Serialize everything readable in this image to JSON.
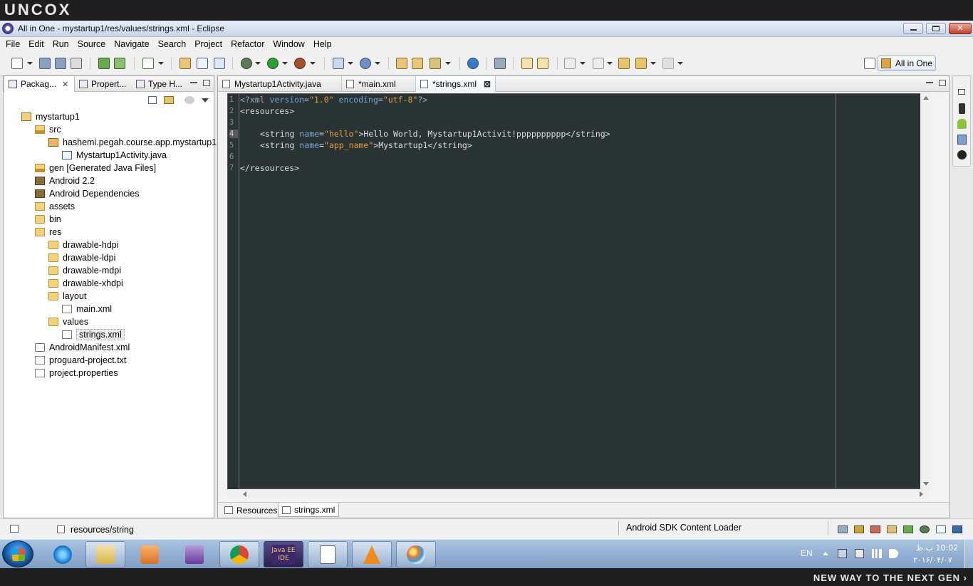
{
  "banner": {
    "logo_text": "UNCOX"
  },
  "window": {
    "title": "All in One - mystartup1/res/values/strings.xml - Eclipse"
  },
  "menu": [
    "File",
    "Edit",
    "Run",
    "Source",
    "Navigate",
    "Search",
    "Project",
    "Refactor",
    "Window",
    "Help"
  ],
  "perspective": {
    "label": "All in One"
  },
  "left_view": {
    "tabs": [
      "Packag...",
      "Propert...",
      "Type H..."
    ],
    "tree": [
      {
        "label": "mystartup1",
        "icon": "project-icon",
        "level": 0
      },
      {
        "label": "src",
        "icon": "source-folder-icon",
        "level": 1
      },
      {
        "label": "hashemi.pegah.course.app.mystartup1",
        "icon": "package-icon",
        "level": 2
      },
      {
        "label": "Mystartup1Activity.java",
        "icon": "java-file-icon",
        "level": 3
      },
      {
        "label": "gen [Generated Java Files]",
        "icon": "source-folder-icon",
        "level": 1
      },
      {
        "label": "Android 2.2",
        "icon": "library-icon",
        "level": 1
      },
      {
        "label": "Android Dependencies",
        "icon": "library-icon",
        "level": 1
      },
      {
        "label": "assets",
        "icon": "folder-icon",
        "level": 1
      },
      {
        "label": "bin",
        "icon": "folder-icon",
        "level": 1
      },
      {
        "label": "res",
        "icon": "folder-icon",
        "level": 1
      },
      {
        "label": "drawable-hdpi",
        "icon": "folder-icon",
        "level": 2
      },
      {
        "label": "drawable-ldpi",
        "icon": "folder-icon",
        "level": 2
      },
      {
        "label": "drawable-mdpi",
        "icon": "folder-icon",
        "level": 2
      },
      {
        "label": "drawable-xhdpi",
        "icon": "folder-icon",
        "level": 2
      },
      {
        "label": "layout",
        "icon": "folder-icon",
        "level": 2
      },
      {
        "label": "main.xml",
        "icon": "xml-file-icon",
        "level": 3
      },
      {
        "label": "values",
        "icon": "folder-icon",
        "level": 2
      },
      {
        "label": "strings.xml",
        "icon": "xml-file-icon",
        "level": 3,
        "selected": true
      },
      {
        "label": "AndroidManifest.xml",
        "icon": "xml-file-icon",
        "level": 1
      },
      {
        "label": "proguard-project.txt",
        "icon": "text-file-icon",
        "level": 1
      },
      {
        "label": "project.properties",
        "icon": "text-file-icon",
        "level": 1
      }
    ]
  },
  "editor": {
    "tabs": [
      "Mystartup1Activity.java",
      "*main.xml",
      "*strings.xml"
    ],
    "active_tab": "*strings.xml",
    "line_numbers": [
      "1",
      "2",
      "3",
      "4",
      "5",
      "6",
      "7"
    ],
    "line1": {
      "a": "<?xml ",
      "b": "version",
      "c": "=",
      "d": "\"1.0\"",
      "e": " ",
      "f": "encoding",
      "g": "=",
      "h": "\"utf-8\"",
      "i": "?>"
    },
    "line2": "<resources>",
    "line4": {
      "a": "<string ",
      "b": "name",
      "c": "=",
      "d": "\"hello\"",
      "e": ">Hello World, Mystartup1Activit!pppppppppp</string>"
    },
    "line5": {
      "a": "<string ",
      "b": "name",
      "c": "=",
      "d": "\"app_name\"",
      "e": ">Mystartup1</string>"
    },
    "line7": "</resources>",
    "bottom_tabs": [
      "Resources",
      "strings.xml"
    ]
  },
  "status": {
    "path": "resources/string",
    "loader": "Android SDK Content Loader"
  },
  "taskbar": {
    "lang": "EN",
    "time": "10:02 ب.ظ",
    "date": "۲۰۱۶/۰۴/۰۷",
    "java_ee_label": "Java EE IDE"
  },
  "footer": {
    "tagline": "NEW WAY TO THE NEXT GEN ›"
  },
  "colors": {
    "editor_bg": "#2b3434",
    "attr": "#6fa3d8",
    "value": "#e39b3a",
    "text": "#dcdcdc"
  }
}
